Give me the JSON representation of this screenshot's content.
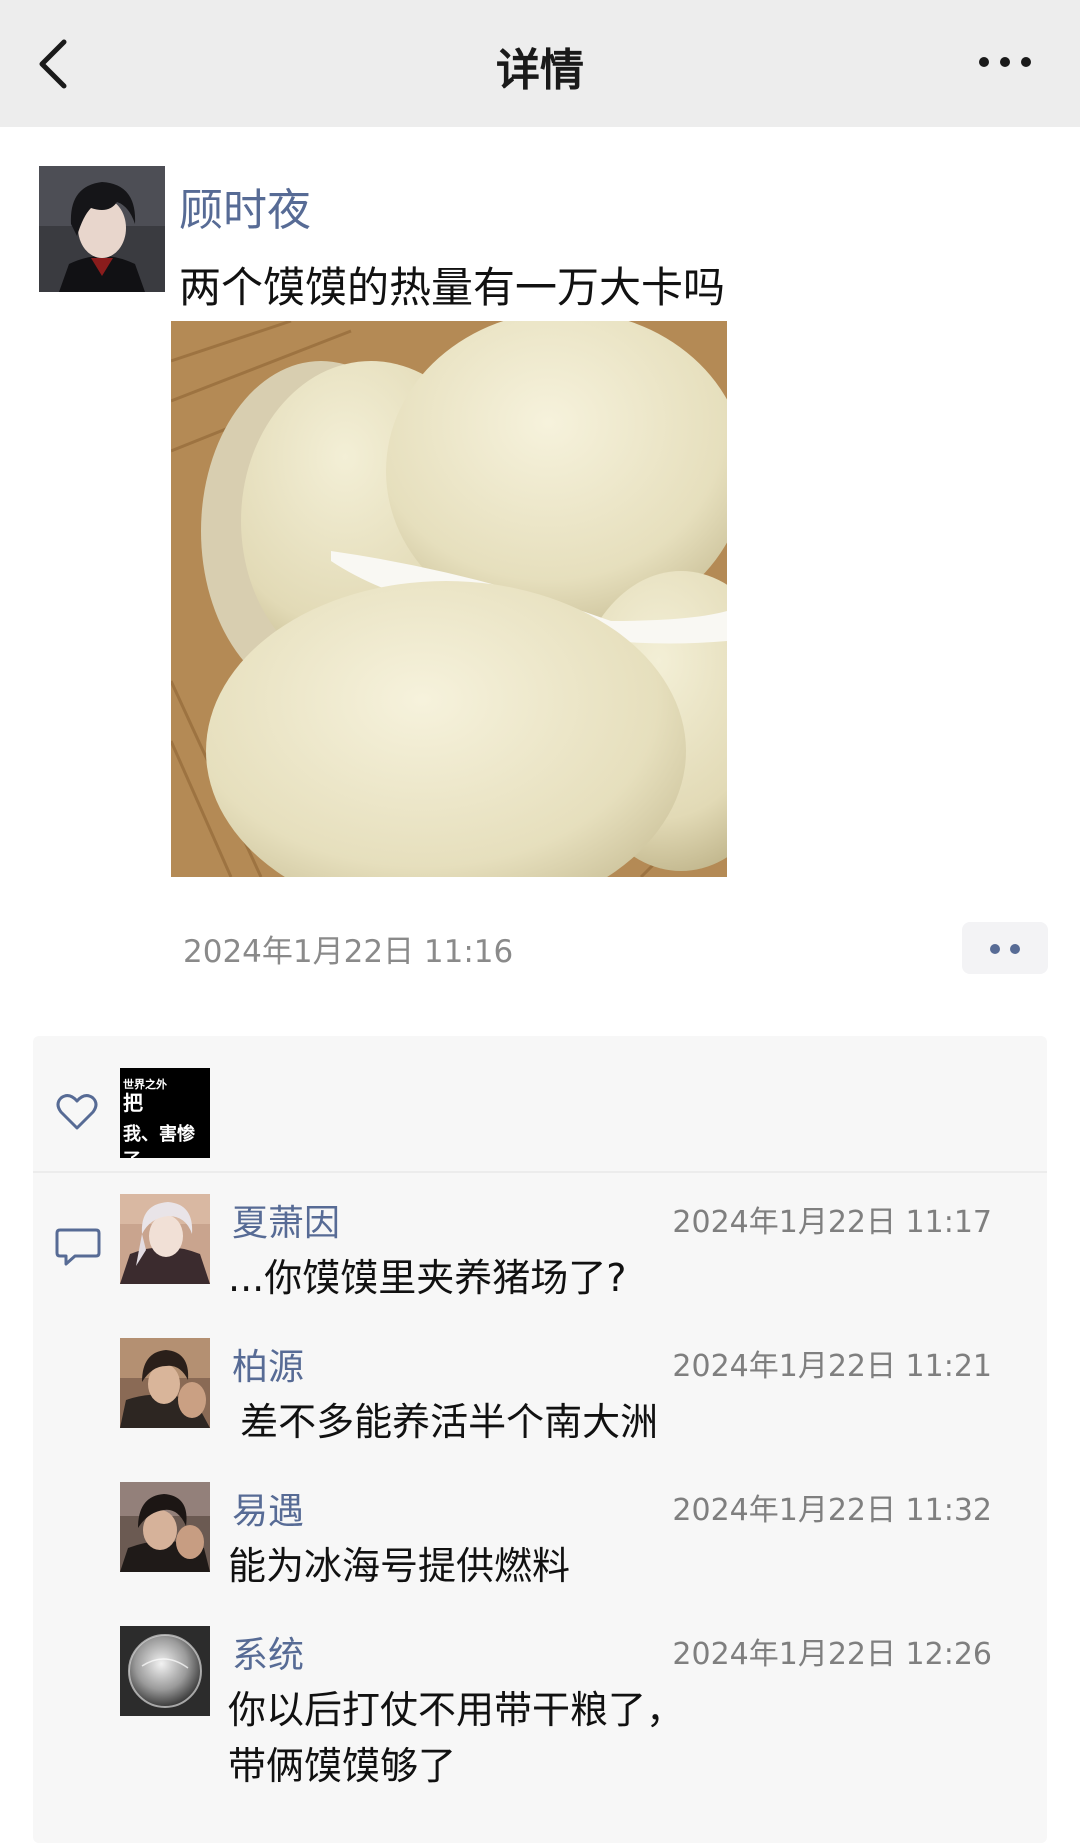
{
  "nav": {
    "title": "详情",
    "back_icon": "chevron-left-icon",
    "more_icon": "ellipsis-icon"
  },
  "post": {
    "author": "顾时夜",
    "text": "两个馍馍的热量有一万大卡吗",
    "time": "2024年1月22日 11:16",
    "photo": "steamed-buns-photo"
  },
  "likes": {
    "icon": "heart-icon",
    "liker_avatar_text": {
      "line1": "世界之外",
      "line2": "把",
      "line3": "我、害惨了"
    }
  },
  "comments_icon": "comment-icon",
  "comments": [
    {
      "name": "夏萧因",
      "time": "2024年1月22日 11:17",
      "text": "...你馍馍里夹养猪场了?"
    },
    {
      "name": "柏源",
      "time": "2024年1月22日 11:21",
      "text": " 差不多能养活半个南大洲"
    },
    {
      "name": "易遇",
      "time": "2024年1月22日 11:32",
      "text": "能为冰海号提供燃料"
    },
    {
      "name": "系统",
      "time": "2024年1月22日 12:26",
      "text": "你以后打仗不用带干粮了，\n带俩馍馍够了"
    }
  ],
  "colors": {
    "navbar_bg": "#ededed",
    "link_blue": "#576b95",
    "panel_bg": "#f7f7f7",
    "meta_gray": "#8a8a8a"
  }
}
